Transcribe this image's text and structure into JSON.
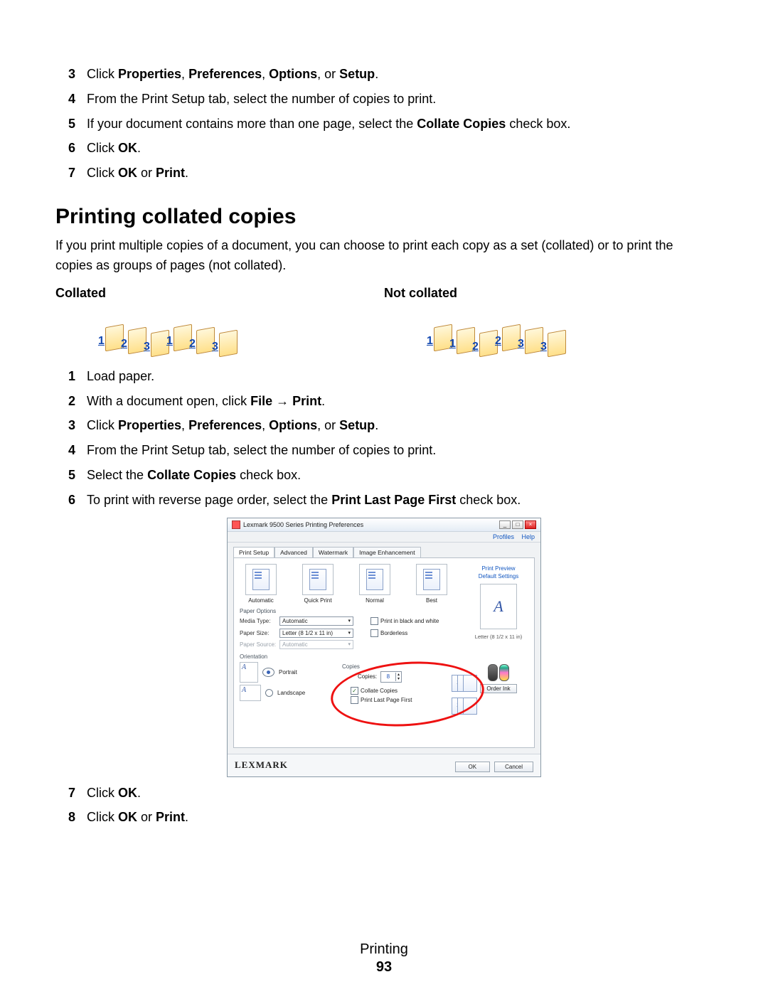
{
  "topSteps": [
    {
      "n": "3",
      "html": "Click <b>Properties</b>, <b>Preferences</b>, <b>Options</b>, or <b>Setup</b>."
    },
    {
      "n": "4",
      "html": "From the Print Setup tab, select the number of copies to print."
    },
    {
      "n": "5",
      "html": "If your document contains more than one page, select the <b>Collate Copies</b> check box."
    },
    {
      "n": "6",
      "html": "Click <b>OK</b>."
    },
    {
      "n": "7",
      "html": "Click <b>OK</b> or <b>Print</b>."
    }
  ],
  "section_heading": "Printing collated copies",
  "section_para": "If you print multiple copies of a document, you can choose to print each copy as a set (collated) or to print the copies as groups of pages (not collated).",
  "collated_label": "Collated",
  "not_collated_label": "Not collated",
  "collated_seq": [
    "1",
    "2",
    "3",
    "1",
    "2",
    "3"
  ],
  "not_collated_seq": [
    "1",
    "1",
    "2",
    "2",
    "3",
    "3"
  ],
  "steps2": [
    {
      "n": "1",
      "html": "Load paper."
    },
    {
      "n": "2",
      "html": "With a document open, click <b>File</b> &#8594; <b>Print</b>."
    },
    {
      "n": "3",
      "html": "Click <b>Properties</b>, <b>Preferences</b>, <b>Options</b>, or <b>Setup</b>."
    },
    {
      "n": "4",
      "html": "From the Print Setup tab, select the number of copies to print."
    },
    {
      "n": "5",
      "html": "Select the <b>Collate Copies</b> check box."
    },
    {
      "n": "6",
      "html": "To print with reverse page order, select the <b>Print Last Page First</b> check box."
    }
  ],
  "steps3": [
    {
      "n": "7",
      "html": "Click <b>OK</b>."
    },
    {
      "n": "8",
      "html": "Click <b>OK</b> or <b>Print</b>."
    }
  ],
  "dialog": {
    "title": "Lexmark 9500 Series Printing Preferences",
    "menubar": [
      "Profiles",
      "Help"
    ],
    "tabs": [
      "Print Setup",
      "Advanced",
      "Watermark",
      "Image Enhancement"
    ],
    "quality": [
      "Automatic",
      "Quick Print",
      "Normal",
      "Best"
    ],
    "side": {
      "preview": "Print Preview",
      "defaults": "Default Settings",
      "paper": "Letter (8 1/2 x 11 in)",
      "order": "Order Ink"
    },
    "paper_options_label": "Paper Options",
    "media_type": {
      "label": "Media Type:",
      "value": "Automatic"
    },
    "paper_size": {
      "label": "Paper Size:",
      "value": "Letter (8 1/2 x 11 in)"
    },
    "paper_source": {
      "label": "Paper Source:",
      "value": "Automatic"
    },
    "print_bw": "Print in black and white",
    "borderless": "Borderless",
    "orientation_label": "Orientation",
    "portrait": "Portrait",
    "landscape": "Landscape",
    "copies_group": "Copies",
    "copies_label": "Copies:",
    "copies_value": "8",
    "collate_copies": "Collate Copies",
    "print_last": "Print Last Page First",
    "brand": "LEXMARK",
    "ok": "OK",
    "cancel": "Cancel"
  },
  "footer": {
    "section": "Printing",
    "page": "93"
  }
}
